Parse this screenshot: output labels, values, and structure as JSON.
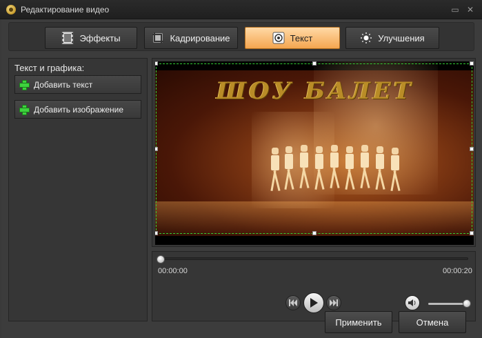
{
  "window": {
    "title": "Редактирование видео",
    "minimize_icon": "minimize-icon",
    "close_icon": "close-icon"
  },
  "tabs": [
    {
      "label": "Эффекты",
      "icon": "film-effects-icon",
      "active": false
    },
    {
      "label": "Кадрирование",
      "icon": "crop-icon",
      "active": false
    },
    {
      "label": "Текст",
      "icon": "text-stamp-icon",
      "active": true
    },
    {
      "label": "Улучшения",
      "icon": "brightness-icon",
      "active": false
    }
  ],
  "left_panel": {
    "heading": "Текст и графика:",
    "add_text_label": "Добавить текст",
    "add_image_label": "Добавить изображение"
  },
  "preview": {
    "overlay_text": "ШОУ БАЛЕТ"
  },
  "player": {
    "time_current": "00:00:00",
    "time_total": "00:00:20",
    "progress_fraction": 0,
    "volume_fraction": 1
  },
  "actions": {
    "apply_label": "Применить",
    "cancel_label": "Отмена"
  },
  "colors": {
    "active_tab": "#f4a650",
    "selection_border": "#35d035",
    "plus_icon": "#3ed23e"
  }
}
